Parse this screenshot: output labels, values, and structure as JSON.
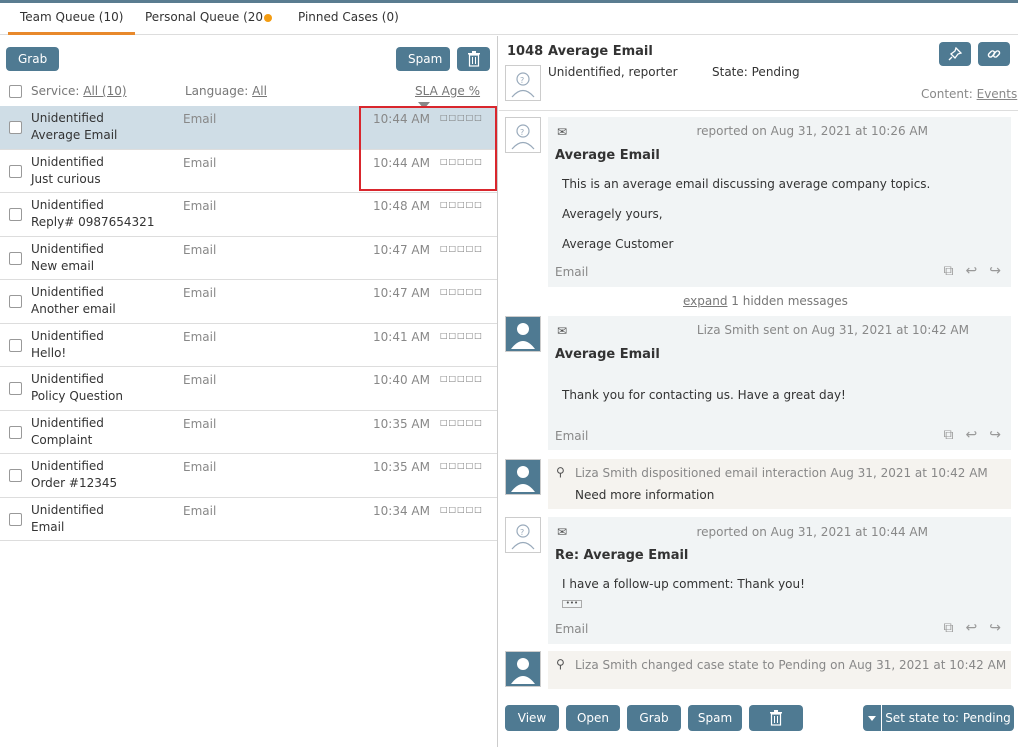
{
  "tabs": [
    {
      "label": "Team Queue (10)"
    },
    {
      "label": "Personal Queue (20"
    },
    {
      "label": "Pinned Cases (0)"
    }
  ],
  "toolbar": {
    "grab": "Grab",
    "spam": "Spam"
  },
  "filters": {
    "service_label": "Service:",
    "service_value": "All (10)",
    "language_label": "Language:",
    "language_value": "All",
    "sla": "SLA Age %"
  },
  "rows": [
    {
      "name": "Unidentified",
      "subject": "Average Email",
      "service": "Email",
      "time": "10:44 AM"
    },
    {
      "name": "Unidentified",
      "subject": "Just curious",
      "service": "Email",
      "time": "10:44 AM"
    },
    {
      "name": "Unidentified",
      "subject": "Reply# 0987654321",
      "service": "Email",
      "time": "10:48 AM"
    },
    {
      "name": "Unidentified",
      "subject": "New email",
      "service": "Email",
      "time": "10:47 AM"
    },
    {
      "name": "Unidentified",
      "subject": "Another email",
      "service": "Email",
      "time": "10:47 AM"
    },
    {
      "name": "Unidentified",
      "subject": "Hello!",
      "service": "Email",
      "time": "10:41 AM"
    },
    {
      "name": "Unidentified",
      "subject": "Policy Question",
      "service": "Email",
      "time": "10:40 AM"
    },
    {
      "name": "Unidentified",
      "subject": "Complaint",
      "service": "Email",
      "time": "10:35 AM"
    },
    {
      "name": "Unidentified",
      "subject": "Order #12345",
      "service": "Email",
      "time": "10:35 AM"
    },
    {
      "name": "Unidentified",
      "subject": "Email",
      "service": "Email",
      "time": "10:34 AM"
    }
  ],
  "sla_indicator": "□□□□□",
  "case": {
    "id": "1048",
    "title": "Average Email",
    "contact": "Unidentified, reporter",
    "state": "State: Pending",
    "content_label": "Content:",
    "content_value": "Events"
  },
  "messages": {
    "m1": {
      "meta": "reported on Aug 31, 2021 at 10:26 AM",
      "title": "Average Email",
      "l1": "This is an average email discussing average company topics.",
      "l2": "Averagely yours,",
      "l3": "Average Customer",
      "channel": "Email"
    },
    "expand_link": "expand",
    "expand_text": "1 hidden messages",
    "m2": {
      "meta": "Liza Smith sent on Aug 31, 2021 at 10:42 AM",
      "title": "Average Email",
      "l1": "Thank you for contacting us. Have a great day!",
      "channel": "Email"
    },
    "n1": {
      "meta": "Liza Smith dispositioned email interaction Aug 31, 2021 at 10:42 AM",
      "body": "Need more information"
    },
    "m3": {
      "meta": "reported on Aug 31, 2021 at 10:44 AM",
      "title": "Re: Average Email",
      "l1": "I have a follow-up comment: Thank you!",
      "channel": "Email"
    },
    "n2": {
      "meta": "Liza Smith changed case state to Pending on Aug 31, 2021 at 10:42 AM"
    }
  },
  "actions": {
    "view": "View",
    "open": "Open",
    "grab": "Grab",
    "spam": "Spam",
    "set_state": "Set state to: Pending"
  }
}
